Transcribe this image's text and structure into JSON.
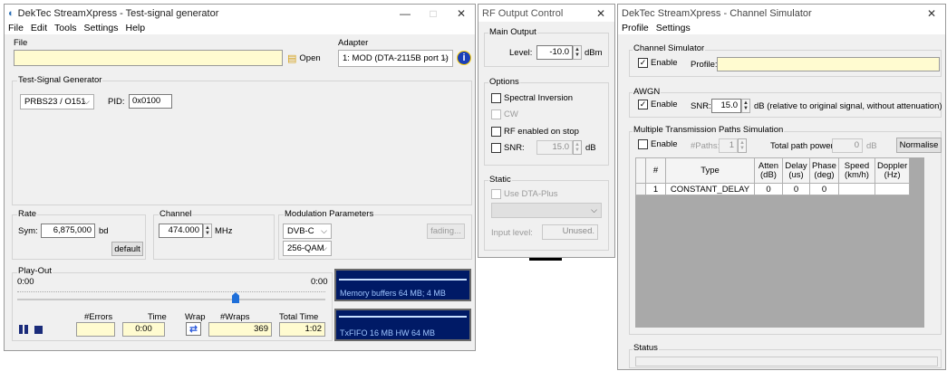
{
  "gen": {
    "title": "DekTec StreamXpress - Test-signal generator",
    "menu": [
      "File",
      "Edit",
      "Tools",
      "Settings",
      "Help"
    ],
    "file_label": "File",
    "open_label": "Open",
    "adapter_label": "Adapter",
    "adapter_value": "1: MOD  (DTA-2115B port 1)",
    "tsg_label": "Test-Signal Generator",
    "tsg_value": "PRBS23 / O151",
    "pid_label": "PID:",
    "pid_value": "0x0100",
    "rate_label": "Rate",
    "sym_label": "Sym:",
    "sym_value": "6,875,000",
    "bd_label": "bd",
    "default_label": "default",
    "channel_label": "Channel",
    "channel_value": "474.000",
    "mhz_label": "MHz",
    "mod_label": "Modulation Parameters",
    "mod_std": "DVB-C",
    "mod_qam": "256-QAM",
    "fading_label": "fading...",
    "playout_label": "Play-Out",
    "time_start": "0:00",
    "time_end": "0:00",
    "errors_label": "#Errors",
    "errors_value": "",
    "time_label": "Time",
    "time_value": "0:00",
    "wrap_label": "Wrap",
    "wraps_label": "#Wraps",
    "wraps_value": "369",
    "total_label": "Total Time",
    "total_value": "1:02",
    "scope1_text": "Memory buffers 64 MB; 4 MB",
    "scope2_text": "TxFIFO 16 MB  HW 64 MB"
  },
  "rf": {
    "title": "RF Output Control",
    "main_output_label": "Main Output",
    "level_label": "Level:",
    "level_value": "-10.0",
    "dbm_label": "dBm",
    "options_label": "Options",
    "spectral_inversion": "Spectral Inversion",
    "cw": "CW",
    "rf_enabled_on_stop": "RF enabled on stop",
    "snr_label": "SNR:",
    "snr_value": "15.0",
    "db_label": "dB",
    "static_label": "Static",
    "use_dta_plus": "Use DTA-Plus",
    "input_level_label": "Input level:",
    "input_level_value": "Unused."
  },
  "sim": {
    "title": "DekTec StreamXpress - Channel Simulator",
    "menu": [
      "Profile",
      "Settings"
    ],
    "channel_sim_label": "Channel Simulator",
    "enable_label": "Enable",
    "profile_label": "Profile:",
    "awgn_label": "AWGN",
    "snr_label": "SNR:",
    "snr_value": "15.0",
    "snr_note": "dB  (relative to original signal, without attenuation)",
    "mtps_label": "Multiple Transmission Paths Simulation",
    "paths_label": "#Paths:",
    "paths_value": "1",
    "total_power_label": "Total path power:",
    "total_power_value": "0",
    "total_power_unit": "dB",
    "normalise_label": "Normalise",
    "columns": [
      "#",
      "Type",
      "Atten (dB)",
      "Delay (us)",
      "Phase (deg)",
      "Speed (km/h)",
      "Doppler (Hz)"
    ],
    "rows": [
      [
        "1",
        "CONSTANT_DELAY",
        "0",
        "0",
        "0",
        "",
        ""
      ]
    ],
    "status_label": "Status"
  }
}
